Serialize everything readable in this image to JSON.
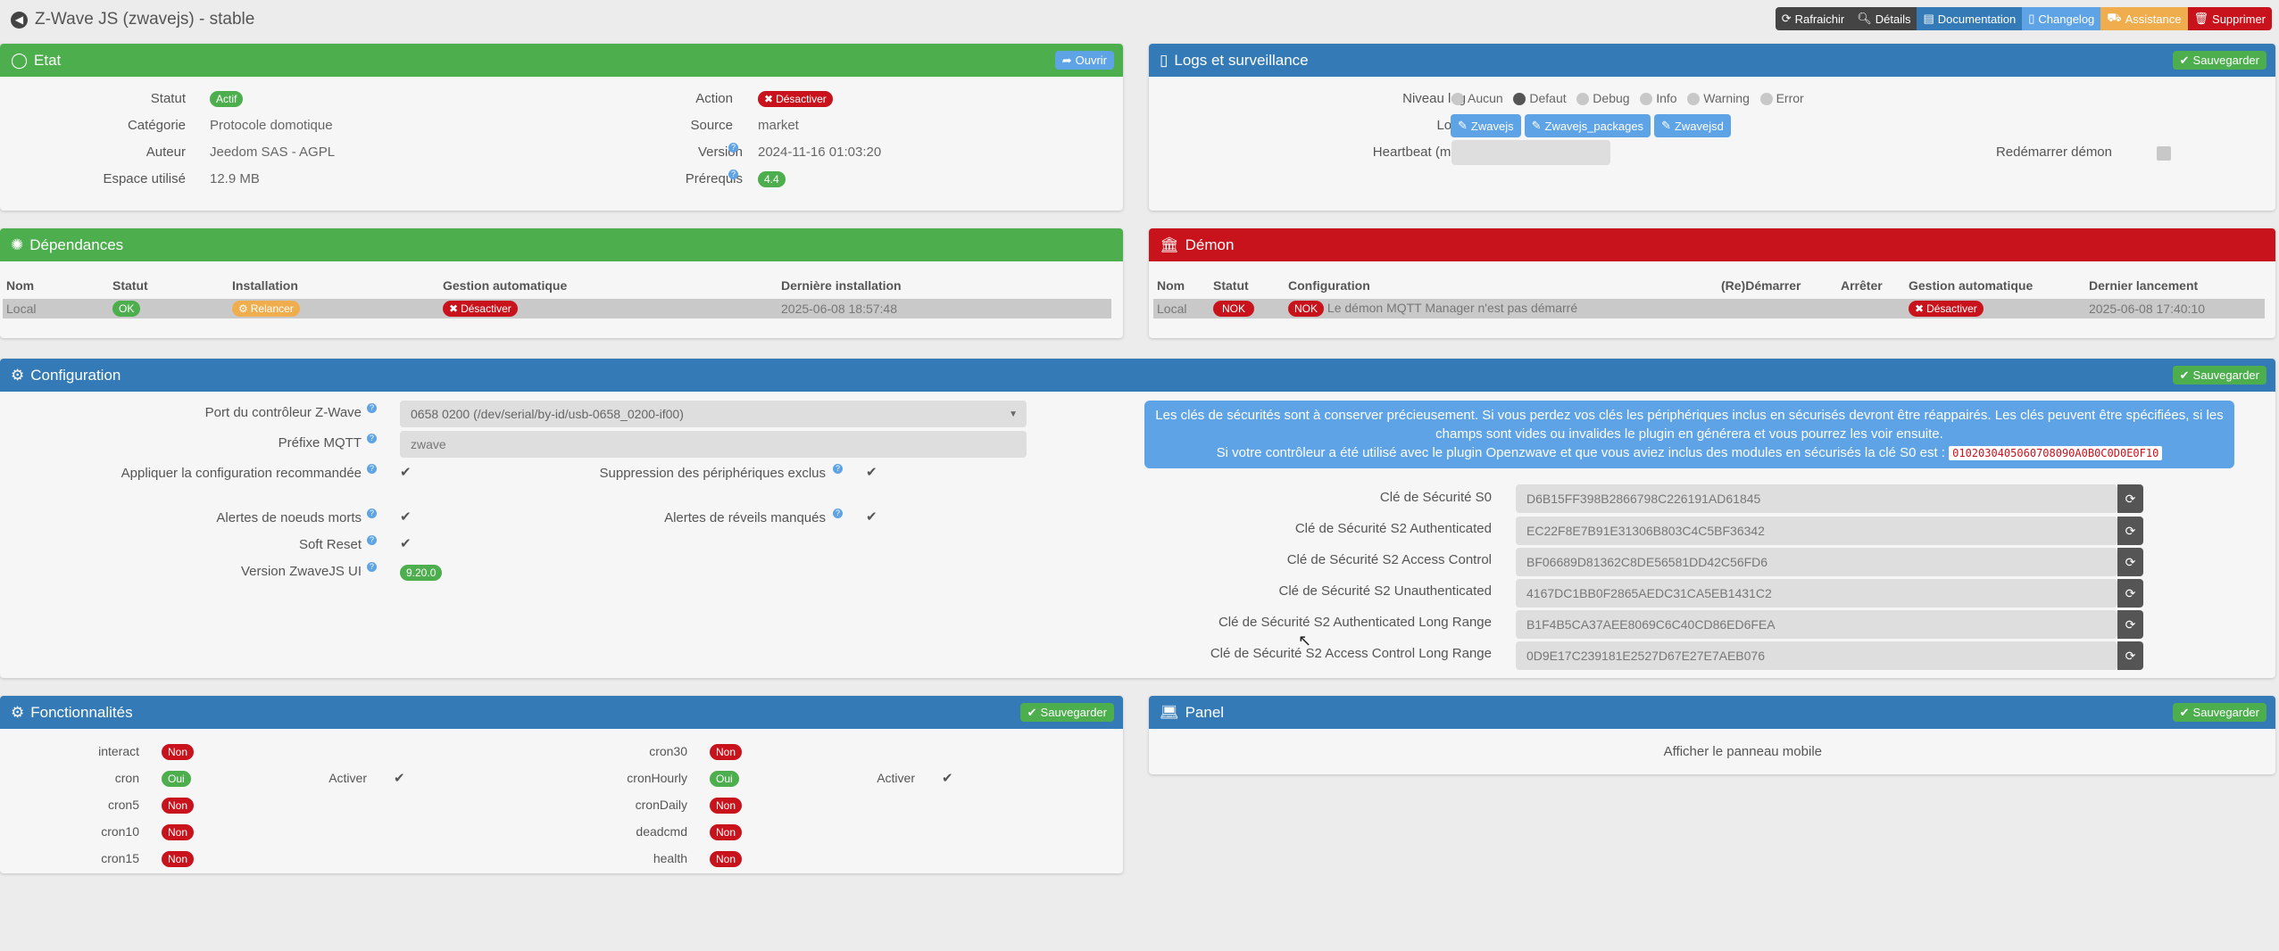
{
  "header": {
    "title": "Z-Wave JS (zwavejs) - stable",
    "buttons": [
      {
        "label": "Rafraichir",
        "icon": "refresh-icon",
        "color": "#444444"
      },
      {
        "label": "Détails",
        "icon": "search-icon",
        "color": "#444444"
      },
      {
        "label": "Documentation",
        "icon": "book-icon",
        "color": "#337ab7"
      },
      {
        "label": "Changelog",
        "icon": "file-icon",
        "color": "#5ea3e6"
      },
      {
        "label": "Assistance",
        "icon": "truck-icon",
        "color": "#f0ad4e"
      },
      {
        "label": "Supprimer",
        "icon": "trash-icon",
        "color": "#c9131c"
      }
    ]
  },
  "etat": {
    "title": "Etat",
    "open_label": "Ouvrir",
    "statut_label": "Statut",
    "statut_value": "Actif",
    "categorie_label": "Catégorie",
    "categorie_value": "Protocole domotique",
    "auteur_label": "Auteur",
    "auteur_value": "Jeedom SAS",
    "licence_value": " - AGPL",
    "espace_label": "Espace utilisé",
    "espace_value": "12.9 MB",
    "action_label": "Action",
    "action_value": "Désactiver",
    "source_label": "Source",
    "source_value": "market",
    "version_label": "Version",
    "version_value": "2024-11-16 01:03:20",
    "prerequis_label": "Prérequis",
    "prerequis_value": "4.4"
  },
  "logs": {
    "title": "Logs et surveillance",
    "save_label": "Sauvegarder",
    "niveau_label": "Niveau log",
    "levels": [
      "Aucun",
      "Defaut",
      "Debug",
      "Info",
      "Warning",
      "Error"
    ],
    "selected_level": "Defaut",
    "logs_label": "Logs",
    "log_buttons": [
      "Zwavejs",
      "Zwavejs_packages",
      "Zwavejsd"
    ],
    "heartbeat_label": "Heartbeat (min)",
    "restart_label": "Redémarrer démon"
  },
  "deps": {
    "title": "Dépendances",
    "headers": [
      "Nom",
      "Statut",
      "Installation",
      "Gestion automatique",
      "Dernière installation"
    ],
    "row": {
      "nom": "Local",
      "statut": "OK",
      "installation": "Relancer",
      "gestion": "Désactiver",
      "derniere": "2025-06-08 18:57:48"
    }
  },
  "demon": {
    "title": "Démon",
    "headers": [
      "Nom",
      "Statut",
      "Configuration",
      "(Re)Démarrer",
      "Arrêter",
      "Gestion automatique",
      "Dernier lancement"
    ],
    "row": {
      "nom": "Local",
      "statut": "NOK",
      "config_badge": "NOK",
      "config_text": "Le démon MQTT Manager n'est pas démarré",
      "gestion": "Désactiver",
      "dernier": "2025-06-08 17:40:10"
    }
  },
  "config": {
    "title": "Configuration",
    "save_label": "Sauvegarder",
    "port_label": "Port du contrôleur Z-Wave",
    "port_value": "0658 0200 (/dev/serial/by-id/usb-0658_0200-if00)",
    "mqtt_label": "Préfixe MQTT",
    "mqtt_value": "zwave",
    "reco_label": "Appliquer la configuration recommandée",
    "suppr_label": "Suppression des périphériques exclus",
    "alertes_noeuds_label": "Alertes de noeuds morts",
    "alertes_reveil_label": "Alertes de réveils manqués",
    "softreset_label": "Soft Reset",
    "zwavejsui_label": "Version ZwaveJS UI",
    "zwavejsui_value": "9.20.0",
    "info_line1": "Les clés de sécurités sont à conserver précieusement. Si vous perdez vos clés les périphériques inclus en sécurisés devront être réappairés. Les clés peuvent être spécifiées, si les champs sont vides ou invalides le plugin en générera et vous pourrez les voir ensuite.",
    "info_line2": "Si votre contrôleur a été utilisé avec le plugin Openzwave et que vous aviez inclus des modules en sécurisés la clé S0 est :",
    "info_code": "0102030405060708090A0B0C0D0E0F10",
    "keys": [
      {
        "label": "Clé de Sécurité S0",
        "value": "D6B15FF398B2866798C226191AD61845"
      },
      {
        "label": "Clé de Sécurité S2 Authenticated",
        "value": "EC22F8E7B91E31306B803C4C5BF36342"
      },
      {
        "label": "Clé de Sécurité S2 Access Control",
        "value": "BF06689D81362C8DE56581DD42C56FD6"
      },
      {
        "label": "Clé de Sécurité S2 Unauthenticated",
        "value": "4167DC1BB0F2865AEDC31CA5EB1431C2"
      },
      {
        "label": "Clé de Sécurité S2 Authenticated Long Range",
        "value": "B1F4B5CA37AEE8069C6C40CD86ED6FEA"
      },
      {
        "label": "Clé de Sécurité S2 Access Control Long Range",
        "value": "0D9E17C239181E2527D67E27E7AEB076"
      }
    ]
  },
  "fonct": {
    "title": "Fonctionnalités",
    "save_label": "Sauvegarder",
    "left": [
      {
        "name": "interact",
        "value": "Non"
      },
      {
        "name": "cron",
        "value": "Oui"
      },
      {
        "name": "cron5",
        "value": "Non"
      },
      {
        "name": "cron10",
        "value": "Non"
      },
      {
        "name": "cron15",
        "value": "Non"
      }
    ],
    "right": [
      {
        "name": "cron30",
        "value": "Non"
      },
      {
        "name": "cronHourly",
        "value": "Oui"
      },
      {
        "name": "cronDaily",
        "value": "Non"
      },
      {
        "name": "deadcmd",
        "value": "Non"
      },
      {
        "name": "health",
        "value": "Non"
      }
    ],
    "activer_label": "Activer"
  },
  "panel": {
    "title": "Panel",
    "save_label": "Sauvegarder",
    "mobile_label": "Afficher le panneau mobile"
  }
}
